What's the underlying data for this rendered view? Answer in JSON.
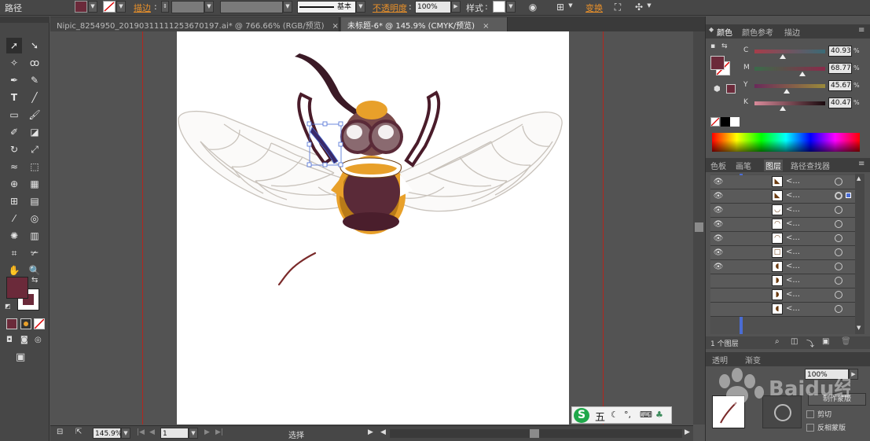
{
  "control_bar": {
    "mode_label": "路径",
    "stroke_label": "描边",
    "stroke_profile": "基本",
    "opacity_label": "不透明度",
    "opacity_value": "100%",
    "style_label": "样式",
    "transform_label": "变换",
    "fill_color": "#6b2a3a"
  },
  "tabs": [
    {
      "label": "Nipic_8254950_20190311111253670197.ai* @ 766.66% (RGB/预览)"
    },
    {
      "label": "未标题-6* @ 145.9% (CMYK/预览)"
    }
  ],
  "tab_close_glyph": "×",
  "status_bar": {
    "zoom": "145.9%",
    "page": "1",
    "tool_status": "选择"
  },
  "color_panel": {
    "tabs": [
      "颜色",
      "颜色参考",
      "描边"
    ],
    "channels": [
      {
        "label": "C",
        "value": "40.93",
        "unit": "%"
      },
      {
        "label": "M",
        "value": "68.77",
        "unit": "%"
      },
      {
        "label": "Y",
        "value": "45.67",
        "unit": "%"
      },
      {
        "label": "K",
        "value": "40.47",
        "unit": "%"
      }
    ],
    "fill_color": "#6b2a3a"
  },
  "layers_panel": {
    "tabs": [
      "色板",
      "画笔",
      "图层",
      "路径查找器"
    ],
    "row_name": "<...",
    "footer_count": "1 个图层"
  },
  "bottom_panel": {
    "tabs": [
      "透明",
      "渐变"
    ],
    "opacity_value": "100%",
    "mask_button": "制作蒙版",
    "clip_label": "剪切",
    "invert_label": "反相蒙版"
  },
  "ime": {
    "mode": "五"
  },
  "watermark": "Baidu经验 jingyan.baidu.com"
}
